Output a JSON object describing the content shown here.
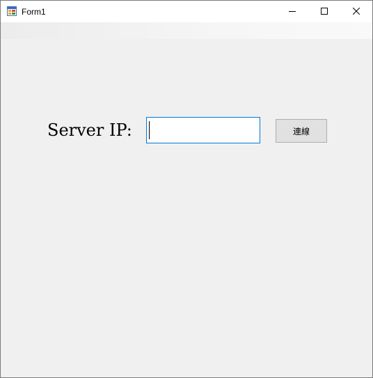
{
  "window": {
    "title": "Form1"
  },
  "caption_buttons": {
    "minimize_icon": "minimize-icon",
    "maximize_icon": "maximize-icon",
    "close_icon": "close-icon"
  },
  "form": {
    "server_label": "Server IP:",
    "ip_input": {
      "value": "",
      "placeholder": ""
    },
    "connect_button_label": "連線"
  },
  "colors": {
    "window_background": "#f0f0f0",
    "title_bar": "#ffffff",
    "input_focus_border": "#0078d7",
    "button_face": "#e1e1e1",
    "button_border": "#adadad"
  }
}
